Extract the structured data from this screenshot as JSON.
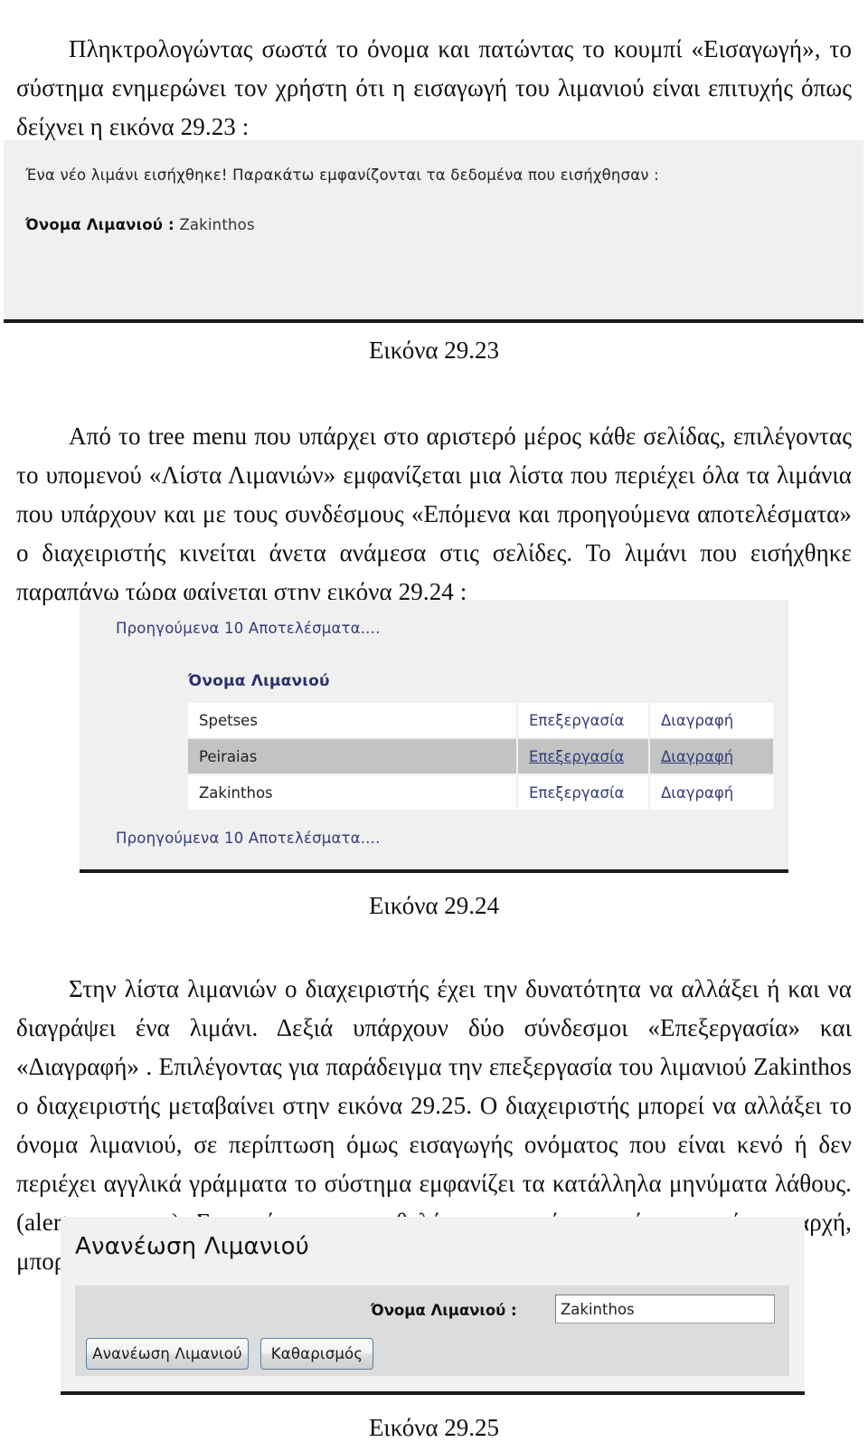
{
  "document": {
    "paragraph_1": "Πληκτρολογώντας σωστά το όνομα και πατώντας το κουμπί «Εισαγωγή», το σύστημα ενημερώνει τον χρήστη ότι η εισαγωγή του λιμανιού είναι επιτυχής όπως δείχνει η εικόνα 29.23 :",
    "paragraph_2": "Από το tree menu που υπάρχει στο αριστερό μέρος κάθε σελίδας, επιλέγοντας το υπομενού «Λίστα Λιμανιών» εμφανίζεται μια λίστα που περιέχει όλα τα λιμάνια που υπάρχουν και με τους συνδέσμους «Επόμενα και προηγούμενα αποτελέσματα» ο διαχειριστής κινείται άνετα ανάμεσα στις σελίδες. Το λιμάνι που εισήχθηκε παραπάνω τώρα φαίνεται στην εικόνα 29.24 :",
    "paragraph_3": "Στην λίστα λιμανιών ο διαχειριστής έχει την δυνατότητα να αλλάξει ή και να διαγράψει ένα λιμάνι. Δεξιά υπάρχουν δύο σύνδεσμοι «Επεξεργασία» και «Διαγραφή» . Επιλέγοντας για παράδειγμα την επεξεργασία του λιμανιού Zakinthos ο διαχειριστής μεταβαίνει στην εικόνα 29.25. Ο διαχειριστής μπορεί να αλλάξει το όνομα λιμανιού, σε περίπτωση όμως εισαγωγής ονόματος που είναι κενό ή δεν περιέχει αγγλικά γράμματα το σύστημα εμφανίζει τα κατάλληλα μηνύματα λάθους. (alert messages). Σε περίπτωση που θελήσει να εισάγει το όνομα  από την αρχή, μπορεί να επιλέξει το κουμπί «Καθαρισμός».",
    "caption_1": "Εικόνα 29.23",
    "caption_2": "Εικόνα 29.24",
    "caption_3": "Εικόνα 29.25"
  },
  "shot_insert_confirm": {
    "message": "Ένα νέο λιμάνι εισήχθηκε! Παρακάτω εμφανίζονται τα δεδομένα που εισήχθησαν :",
    "field_label": "Όνομα Λιμανιού :",
    "field_value": "Zakinthos"
  },
  "shot_port_list": {
    "pager_top_label": "Προηγούμενα 10 Αποτελέσματα....",
    "pager_bottom_label": "Προηγούμενα 10 Αποτελέσματα....",
    "list_heading": "Όνομα Λιμανιού",
    "rows": [
      {
        "name": "Spetses",
        "edit_label": "Επεξεργασία",
        "delete_label": "Διαγραφή",
        "hovered": false
      },
      {
        "name": "Peiraias",
        "edit_label": "Επεξεργασία",
        "delete_label": "Διαγραφή",
        "hovered": true
      },
      {
        "name": "Zakinthos",
        "edit_label": "Επεξεργασία",
        "delete_label": "Διαγραφή",
        "hovered": false
      }
    ]
  },
  "shot_update_form": {
    "title": "Ανανέωση Λιμανιού",
    "field_label": "Όνομα Λιμανιού :",
    "field_value": "Zakinthos",
    "field_placeholder": "",
    "submit_label": "Ανανέωση Λιμανιού",
    "clear_label": "Καθαρισμός"
  },
  "colors": {
    "link": "#343a7a",
    "heading": "#2b2f70",
    "shot_background": "#f0f0f0",
    "row_hover": "#c3c3c3",
    "panel": "#dcdcdc",
    "rule": "#1b1b1b"
  }
}
